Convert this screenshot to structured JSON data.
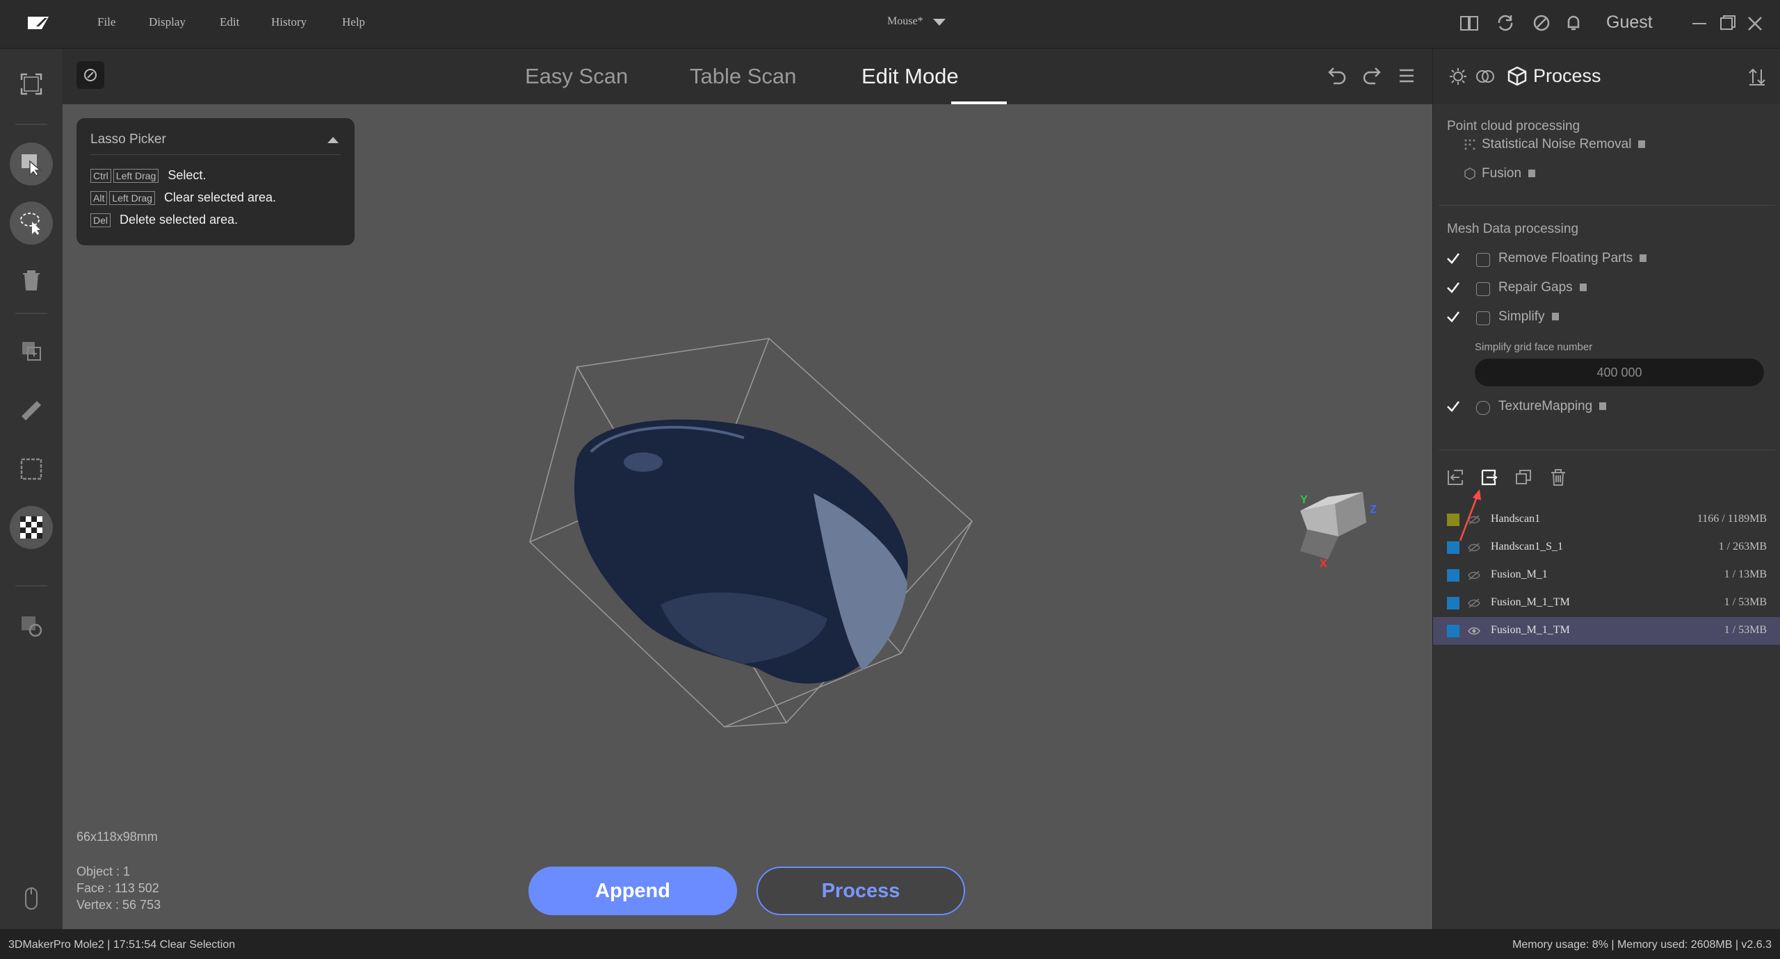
{
  "menu": [
    "File",
    "Display",
    "Edit",
    "History",
    "Help"
  ],
  "document_title": "Mouse*",
  "user_label": "Guest",
  "modes": [
    {
      "label": "Easy Scan",
      "active": false
    },
    {
      "label": "Table Scan",
      "active": false
    },
    {
      "label": "Edit Mode",
      "active": true
    }
  ],
  "lasso": {
    "title": "Lasso Picker",
    "rows": [
      {
        "keys": [
          "Ctrl",
          "Left Drag"
        ],
        "desc": "Select."
      },
      {
        "keys": [
          "Alt",
          "Left Drag"
        ],
        "desc": "Clear selected area."
      },
      {
        "keys": [
          "Del"
        ],
        "desc": "Delete selected area."
      }
    ]
  },
  "info": {
    "dimensions": "66x118x98mm",
    "object": "Object : 1",
    "face": "Face : 113 502",
    "vertex": "Vertex : 56 753"
  },
  "buttons": {
    "append": "Append",
    "process": "Process"
  },
  "status": {
    "left": "3DMakerPro Mole2  |  17:51:54 Clear Selection",
    "right": "Memory usage: 8% | Memory used: 2608MB | v2.6.3"
  },
  "right_panel": {
    "title": "Process",
    "point_cloud_section": "Point cloud processing",
    "point_cloud_items": [
      "Statistical Noise Removal",
      "Fusion"
    ],
    "mesh_section": "Mesh Data processing",
    "mesh_items": [
      {
        "label": "Remove Floating Parts",
        "checked": true
      },
      {
        "label": "Repair Gaps",
        "checked": true
      },
      {
        "label": "Simplify",
        "checked": true
      }
    ],
    "simplify_label": "Simplify grid face number",
    "simplify_value": "400 000",
    "texture_item": {
      "label": "TextureMapping",
      "checked": true
    }
  },
  "objects": [
    {
      "name": "Handscan1",
      "count": "1166 / 1189MB",
      "color": "#8a8a1a",
      "visible": false,
      "selected": false
    },
    {
      "name": "Handscan1_S_1",
      "count": "1 / 263MB",
      "color": "#1a7ac0",
      "visible": false,
      "selected": false
    },
    {
      "name": "Fusion_M_1",
      "count": "1 / 13MB",
      "color": "#1a7ac0",
      "visible": false,
      "selected": false
    },
    {
      "name": "Fusion_M_1_TM",
      "count": "1 / 53MB",
      "color": "#1a7ac0",
      "visible": false,
      "selected": false
    },
    {
      "name": "Fusion_M_1_TM",
      "count": "1 / 53MB",
      "color": "#1a7ac0",
      "visible": true,
      "selected": true
    }
  ],
  "gizmo_axes": {
    "x": "X",
    "y": "Y",
    "z": "Z"
  },
  "colors": {
    "accent": "#6a8cff",
    "selected_row": "#4a4a66"
  }
}
